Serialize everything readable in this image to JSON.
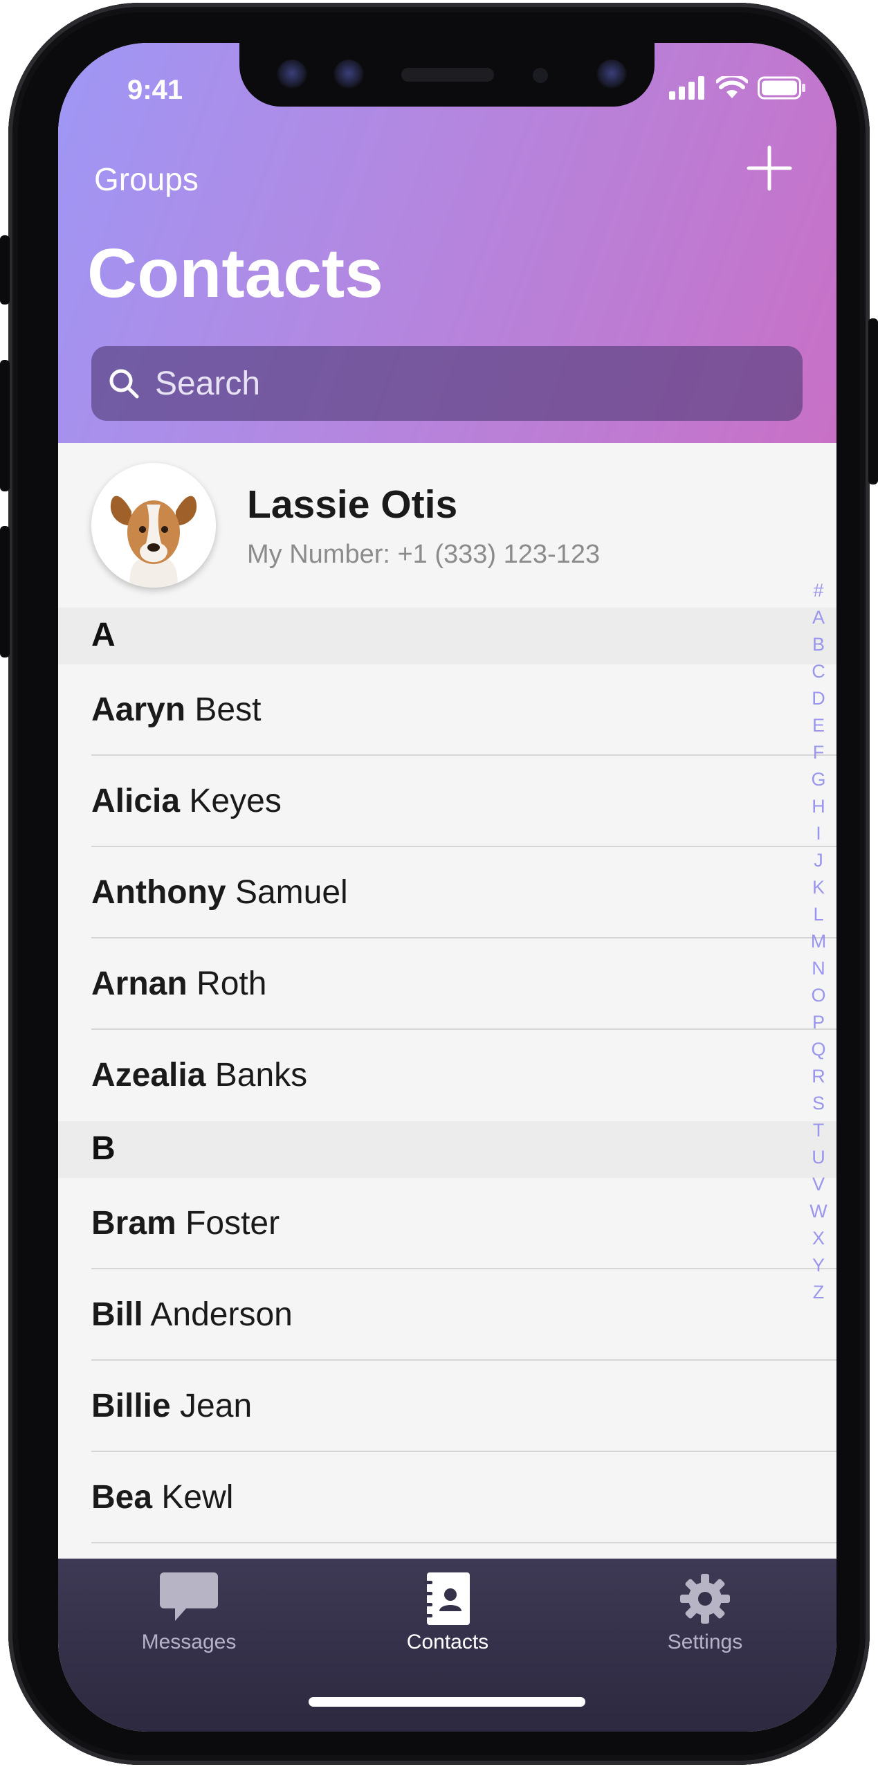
{
  "status_bar": {
    "time": "9:41"
  },
  "header": {
    "groups_label": "Groups",
    "title": "Contacts",
    "search_placeholder": "Search"
  },
  "me_card": {
    "name": "Lassie Otis",
    "number": "My Number: +1 (333) 123-123"
  },
  "sections": [
    {
      "letter": "A",
      "contacts": [
        {
          "first": "Aaryn",
          "last": "Best"
        },
        {
          "first": "Alicia",
          "last": "Keyes"
        },
        {
          "first": "Anthony",
          "last": "Samuel"
        },
        {
          "first": "Arnan",
          "last": "Roth"
        },
        {
          "first": "Azealia",
          "last": "Banks"
        }
      ]
    },
    {
      "letter": "B",
      "contacts": [
        {
          "first": "Bram",
          "last": "Foster"
        },
        {
          "first": "Bill",
          "last": "Anderson"
        },
        {
          "first": "Billie",
          "last": "Jean"
        },
        {
          "first": "Bea",
          "last": "Kewl"
        }
      ]
    }
  ],
  "index_letters": [
    "#",
    "A",
    "B",
    "C",
    "D",
    "E",
    "F",
    "G",
    "H",
    "I",
    "J",
    "K",
    "L",
    "M",
    "N",
    "O",
    "P",
    "Q",
    "R",
    "S",
    "T",
    "U",
    "V",
    "W",
    "X",
    "Y",
    "Z"
  ],
  "tab_bar": {
    "messages_label": "Messages",
    "contacts_label": "Contacts",
    "settings_label": "Settings",
    "active": "Contacts"
  },
  "colors": {
    "header_gradient_start": "#9f97f5",
    "header_gradient_end": "#c870c6",
    "index_accent": "#9a96ee",
    "tab_bar_bg": "#35314a"
  }
}
